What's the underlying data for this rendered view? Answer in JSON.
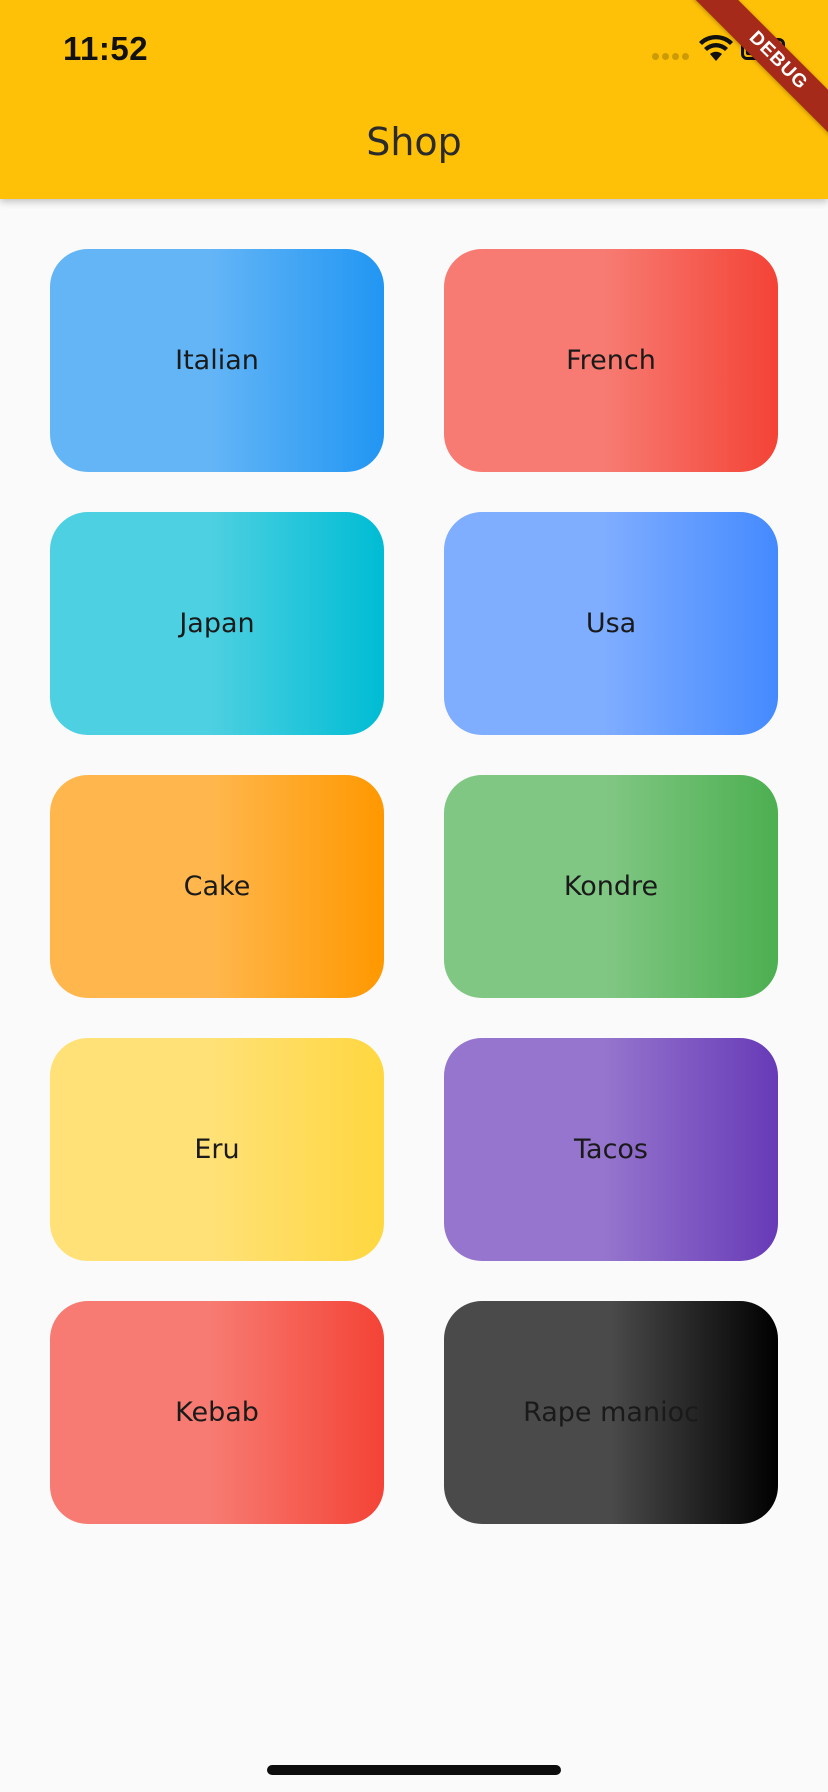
{
  "status_bar": {
    "time": "11:52"
  },
  "debug_banner": "DEBUG",
  "app_bar": {
    "title": "Shop",
    "color": "#ffc107"
  },
  "categories": [
    {
      "label": "Italian",
      "colors": [
        "#64b5f6",
        "#2196f3"
      ]
    },
    {
      "label": "French",
      "colors": [
        "#f77b72",
        "#f44336"
      ]
    },
    {
      "label": "Japan",
      "colors": [
        "#4dd0e1",
        "#00bcd4"
      ]
    },
    {
      "label": "Usa",
      "colors": [
        "#7fadff",
        "#448aff"
      ]
    },
    {
      "label": "Cake",
      "colors": [
        "#ffb74d",
        "#ff9800"
      ]
    },
    {
      "label": "Kondre",
      "colors": [
        "#81c784",
        "#4caf50"
      ]
    },
    {
      "label": "Eru",
      "colors": [
        "#ffe177",
        "#ffd740"
      ]
    },
    {
      "label": "Tacos",
      "colors": [
        "#9575cd",
        "#673ab7"
      ]
    },
    {
      "label": "Kebab",
      "colors": [
        "#f77b72",
        "#f44336"
      ]
    },
    {
      "label": "Rape manioc",
      "colors": [
        "#4a4a4a",
        "#000000"
      ]
    }
  ]
}
